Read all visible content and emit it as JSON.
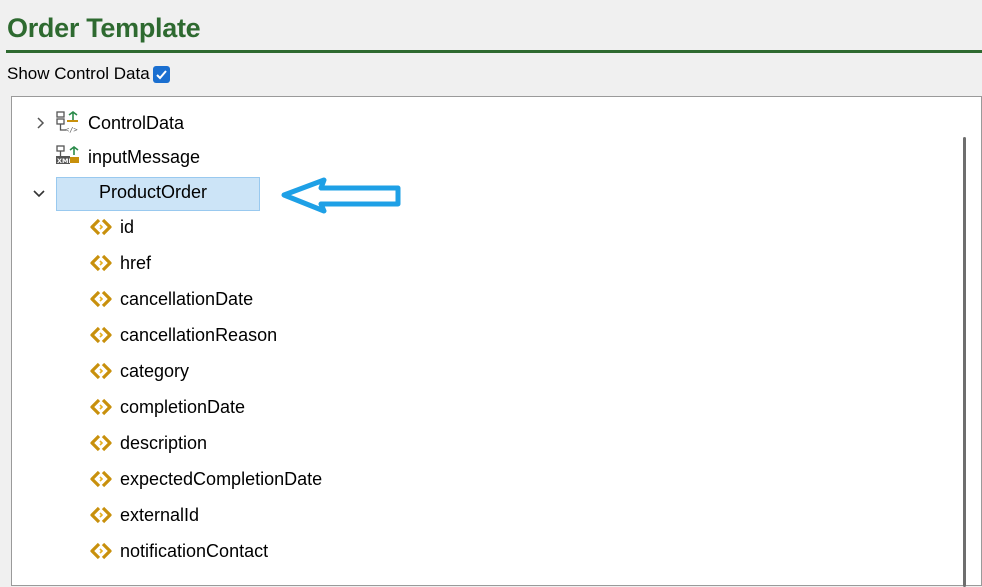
{
  "header": {
    "title": "Order Template"
  },
  "show_control": {
    "label": "Show Control Data",
    "checked": true
  },
  "tree": {
    "control_data": "ControlData",
    "input_message": "inputMessage",
    "product_order": "ProductOrder",
    "children": [
      "id",
      "href",
      "cancellationDate",
      "cancellationReason",
      "category",
      "completionDate",
      "description",
      "expectedCompletionDate",
      "externalId",
      "notificationContact"
    ]
  },
  "colors": {
    "title_green": "#2e6a30",
    "selection": "#cce4f7",
    "element_icon": "#c8900c",
    "annotation_arrow": "#1ea0e6"
  },
  "icons": {
    "collapsed": "chevron-right-icon",
    "expanded": "chevron-down-icon",
    "control_data": "schema-tree-icon",
    "input_message": "xml-message-icon",
    "element": "xml-element-icon"
  }
}
